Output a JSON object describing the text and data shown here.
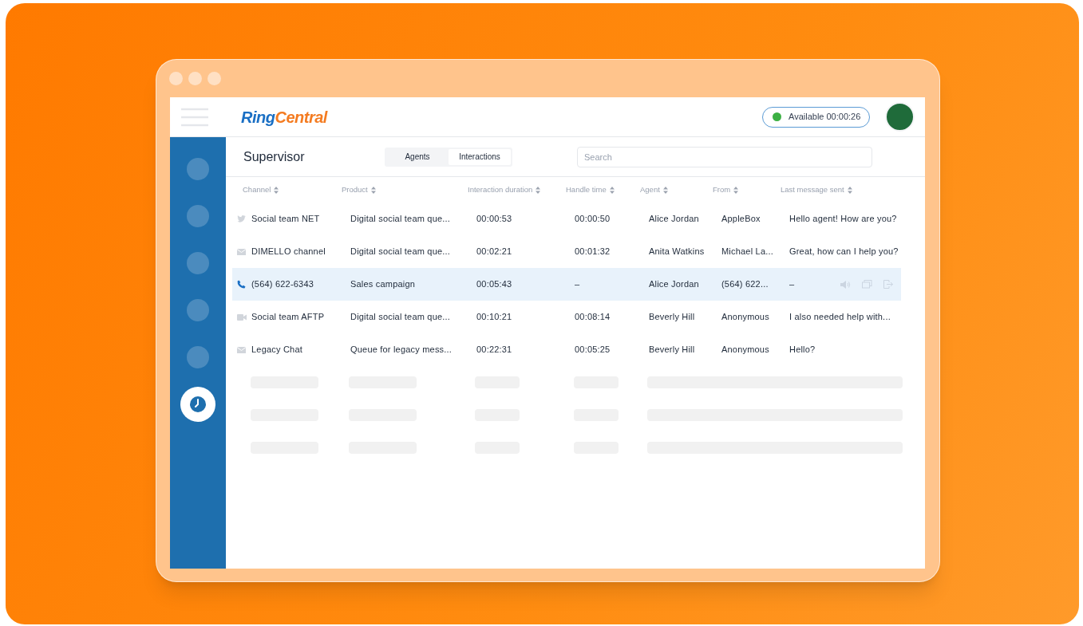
{
  "logo_parts": [
    {
      "text": "Ring",
      "color": "#1a6fc4"
    },
    {
      "text": "Central",
      "color": "#f47b20"
    }
  ],
  "status": {
    "label": "Available 00:00:26"
  },
  "sidebar": {
    "items": [
      {
        "kind": "blank",
        "selected": false
      },
      {
        "kind": "blank",
        "selected": false
      },
      {
        "kind": "blank",
        "selected": false
      },
      {
        "kind": "blank",
        "selected": false
      },
      {
        "kind": "blank",
        "selected": false
      },
      {
        "kind": "clock",
        "selected": true
      }
    ]
  },
  "page_title": "Supervisor",
  "tabs": [
    {
      "label": "Agents",
      "selected": false
    },
    {
      "label": "Interactions",
      "selected": true
    }
  ],
  "search": {
    "placeholder": "Search"
  },
  "table": {
    "columns": [
      "Channel",
      "Product",
      "Interaction duration",
      "Handle time",
      "Agent",
      "From",
      "Last message sent"
    ],
    "rows": [
      {
        "kind": "twitter",
        "selected": false,
        "cells": [
          "Social team NET",
          "Digital social team que...",
          "00:00:53",
          "00:00:50",
          "Alice Jordan",
          "AppleBox",
          "Hello agent! How are you?"
        ]
      },
      {
        "kind": "email",
        "selected": false,
        "cells": [
          "DIMELLO channel",
          "Digital social team que...",
          "00:02:21",
          "00:01:32",
          "Anita Watkins",
          "Michael La...",
          "Great, how can I help you?"
        ]
      },
      {
        "kind": "phone",
        "selected": true,
        "cells": [
          "(564) 622-6343",
          "Sales campaign",
          "00:05:43",
          "–",
          "Alice Jordan",
          "(564) 622...",
          "–"
        ]
      },
      {
        "kind": "video",
        "selected": false,
        "cells": [
          "Social team AFTP",
          "Digital social team que...",
          "00:10:21",
          "00:08:14",
          "Beverly Hill",
          "Anonymous",
          "I also needed help with..."
        ]
      },
      {
        "kind": "email",
        "selected": false,
        "cells": [
          "Legacy Chat",
          "Queue for legacy mess...",
          "00:22:31",
          "00:05:25",
          "Beverly Hill",
          "Anonymous",
          "Hello?"
        ]
      }
    ]
  }
}
